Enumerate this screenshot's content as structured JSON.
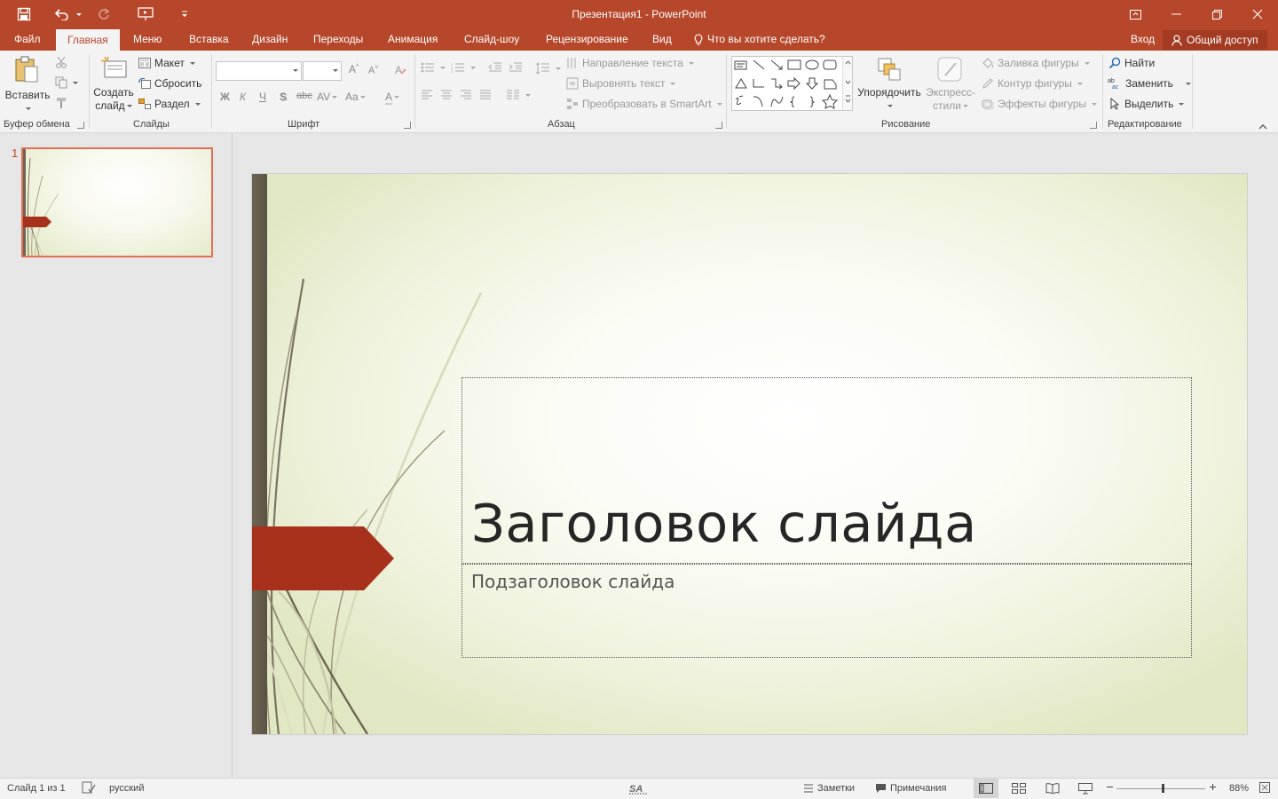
{
  "window": {
    "title": "Презентация1 - PowerPoint"
  },
  "tabs": [
    "Файл",
    "Главная",
    "Меню",
    "Вставка",
    "Дизайн",
    "Переходы",
    "Анимация",
    "Слайд-шоу",
    "Рецензирование",
    "Вид"
  ],
  "active_tab": "Главная",
  "tell_me": "Что вы хотите сделать?",
  "account": {
    "signin": "Вход",
    "share": "Общий доступ"
  },
  "ribbon": {
    "clipboard": {
      "label": "Буфер обмена",
      "paste": "Вставить"
    },
    "slides": {
      "label": "Слайды",
      "new_slide_1": "Создать",
      "new_slide_2": "слайд",
      "layout": "Макет",
      "reset": "Сбросить",
      "section": "Раздел"
    },
    "font": {
      "label": "Шрифт",
      "bold": "Ж",
      "italic": "К",
      "underline": "Ч",
      "shadow": "S",
      "strike": "abc",
      "aa": "Aa"
    },
    "paragraph": {
      "label": "Абзац",
      "text_direction": "Направление текста",
      "align_text": "Выровнять текст",
      "smartart": "Преобразовать в SmartArt"
    },
    "drawing": {
      "label": "Рисование",
      "arrange": "Упорядочить",
      "quick_styles_1": "Экспресс-",
      "quick_styles_2": "стили",
      "shape_fill": "Заливка фигуры",
      "shape_outline": "Контур фигуры",
      "shape_effects": "Эффекты фигуры"
    },
    "editing": {
      "label": "Редактирование",
      "find": "Найти",
      "replace": "Заменить",
      "select": "Выделить"
    }
  },
  "thumbnails": [
    {
      "number": "1"
    }
  ],
  "slide": {
    "title": "Заголовок слайда",
    "subtitle": "Подзаголовок слайда"
  },
  "status": {
    "slide_info": "Слайд 1 из 1",
    "language": "русский",
    "notes": "Заметки",
    "comments": "Примечания",
    "zoom": "88%",
    "zoom_fraction": 0.52
  },
  "colors": {
    "accent": "#b7472a",
    "slide_bar": "#6e6452",
    "arrow": "#a8311b"
  }
}
